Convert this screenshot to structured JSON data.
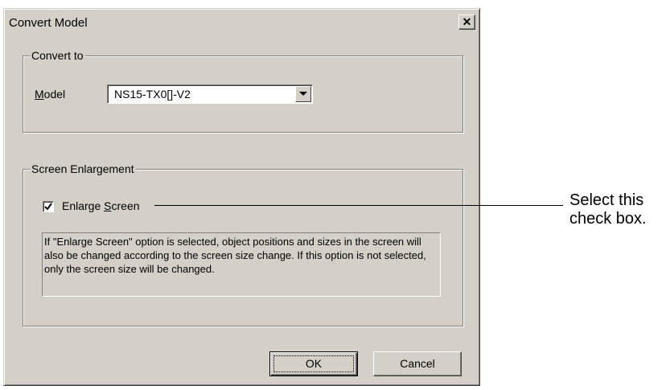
{
  "window": {
    "title": "Convert Model",
    "close_glyph": "✕"
  },
  "convert_to": {
    "group_label": "Convert to",
    "model_label_prefix": "",
    "model_label_accel": "M",
    "model_label_rest": "odel",
    "model_value": "NS15-TX0[]-V2"
  },
  "screen_enlargement": {
    "group_label": "Screen Enlargement",
    "checkbox_checked": true,
    "checkbox_label_prefix": "Enlarge ",
    "checkbox_label_accel": "S",
    "checkbox_label_rest": "creen",
    "info_text": "If \"Enlarge Screen\" option is selected, object positions and sizes in the screen will also be changed according to the screen size change. If this option is not selected, only the screen size will be changed."
  },
  "buttons": {
    "ok": "OK",
    "cancel": "Cancel"
  },
  "annotation": {
    "line1": "Select this",
    "line2": "check box."
  },
  "colors": {
    "dialog_bg": "#d4d0c8",
    "shadow": "#808080",
    "highlight": "#ffffff"
  },
  "icons": {
    "close": "close-icon",
    "dropdown": "chevron-down-icon",
    "check": "checkmark-icon"
  }
}
